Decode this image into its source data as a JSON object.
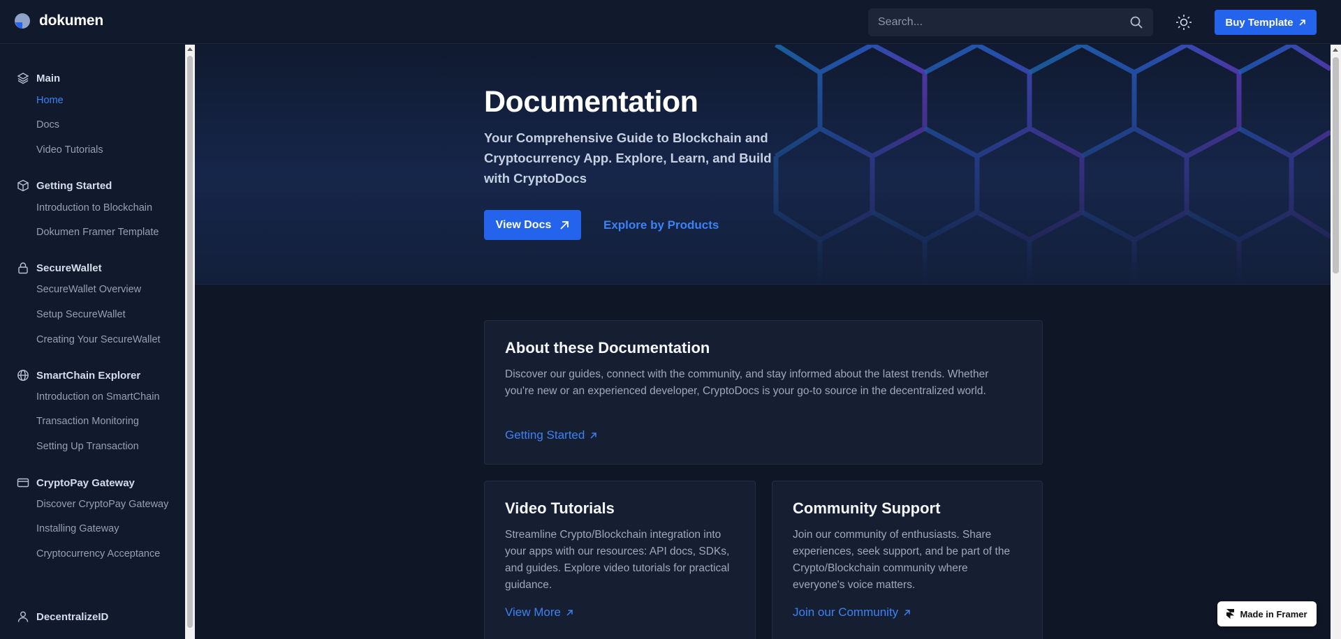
{
  "brand": {
    "name": "dokumen"
  },
  "search": {
    "placeholder": "Search..."
  },
  "header": {
    "buy_label": "Buy Template"
  },
  "sidebar": {
    "groups": [
      {
        "title": "Main",
        "icon": "layers-icon",
        "items": [
          "Home",
          "Docs",
          "Video Tutorials"
        ]
      },
      {
        "title": "Getting Started",
        "icon": "box-icon",
        "items": [
          "Introduction to Blockchain",
          "Dokumen Framer Template"
        ]
      },
      {
        "title": "SecureWallet",
        "icon": "lock-icon",
        "items": [
          "SecureWallet Overview",
          "Setup SecureWallet",
          "Creating Your SecureWallet"
        ]
      },
      {
        "title": "SmartChain Explorer",
        "icon": "globe-icon",
        "items": [
          "Introduction on SmartChain",
          "Transaction Monitoring",
          "Setting Up Transaction"
        ]
      },
      {
        "title": "CryptoPay Gateway",
        "icon": "credit-card-icon",
        "items": [
          "Discover CryptoPay Gateway",
          "Installing Gateway",
          "Cryptocurrency Acceptance"
        ]
      },
      {
        "title": "DecentralizeID",
        "icon": "user-icon",
        "items": []
      }
    ],
    "active_item": "Home"
  },
  "hero": {
    "title": "Documentation",
    "subtitle": "Your Comprehensive Guide to Blockchain and Cryptocurrency App. Explore, Learn, and Build with CryptoDocs",
    "primary_button": "View Docs",
    "secondary_link": "Explore by Products"
  },
  "cards": {
    "about": {
      "title": "About these Documentation",
      "body": "Discover our guides, connect with the community, and stay informed about the latest trends. Whether you're new or an experienced developer, CryptoDocs is your go-to source in the decentralized world.",
      "link": "Getting Started"
    },
    "video": {
      "title": "Video Tutorials",
      "body": "Streamline Crypto/Blockchain integration into your apps with our resources: API docs, SDKs, and guides. Explore video tutorials for practical guidance.",
      "link": "View More"
    },
    "community": {
      "title": "Community Support",
      "body": "Join our community of enthusiasts. Share experiences, seek support, and be part of the Crypto/Blockchain community where everyone's voice matters.",
      "link": "Join our Community"
    }
  },
  "badge": {
    "label": "Made in Framer"
  },
  "colors": {
    "accent": "#2463eb",
    "link": "#3b82f6",
    "background": "#0f1626",
    "sidebar": "#111a2c"
  }
}
